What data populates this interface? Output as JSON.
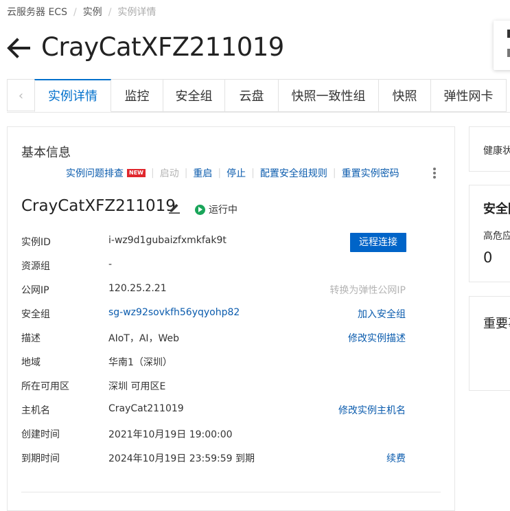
{
  "breadcrumb": [
    "云服务器 ECS",
    "实例",
    "实例详情"
  ],
  "page_title": "CrayCatXFZ211019",
  "tabs": [
    {
      "label": "实例详情",
      "active": true
    },
    {
      "label": "监控"
    },
    {
      "label": "安全组"
    },
    {
      "label": "云盘"
    },
    {
      "label": "快照一致性组"
    },
    {
      "label": "快照"
    },
    {
      "label": "弹性网卡"
    }
  ],
  "basic_info": {
    "heading": "基本信息",
    "actions": {
      "troubleshoot": "实例问题排查",
      "new_badge": "NEW",
      "start": "启动",
      "restart": "重启",
      "stop": "停止",
      "sg_rules": "配置安全组规则",
      "reset_password": "重置实例密码"
    },
    "instance_name": "CrayCatXFZ211019",
    "status": "运行中",
    "rows": [
      {
        "label": "实例ID",
        "value": "i-wz9d1gubaizfxmkfak9t"
      },
      {
        "label": "资源组",
        "value": "-"
      },
      {
        "label": "公网IP",
        "value": "120.25.2.21",
        "action": "转换为弹性公网IP"
      },
      {
        "label": "安全组",
        "value": "sg-wz92sovkfh56yqyohp82",
        "action": "加入安全组"
      },
      {
        "label": "描述",
        "value": "AIoT，AI，Web",
        "action": "修改实例描述"
      },
      {
        "label": "地域",
        "value": "华南1（深圳）"
      },
      {
        "label": "所在可用区",
        "value": "深圳 可用区E"
      },
      {
        "label": "主机名",
        "value": "CrayCat211019",
        "action": "修改实例主机名"
      },
      {
        "label": "创建时间",
        "value": "2021年10月19日 19:00:00"
      },
      {
        "label": "到期时间",
        "value": "2024年10月19日 23:59:59 到期",
        "action": "续费"
      }
    ],
    "remote_connect": "远程连接"
  },
  "side": {
    "health_label": "健康状",
    "security_title": "安全防",
    "high_risk_label": "高危应",
    "high_risk_count": "0",
    "important_title": "重要事"
  },
  "colors": {
    "accent": "#0070cc",
    "link": "#0a5bad",
    "button": "#0064c8",
    "running": "#1aa55a",
    "new_badge": "#e0272d"
  }
}
